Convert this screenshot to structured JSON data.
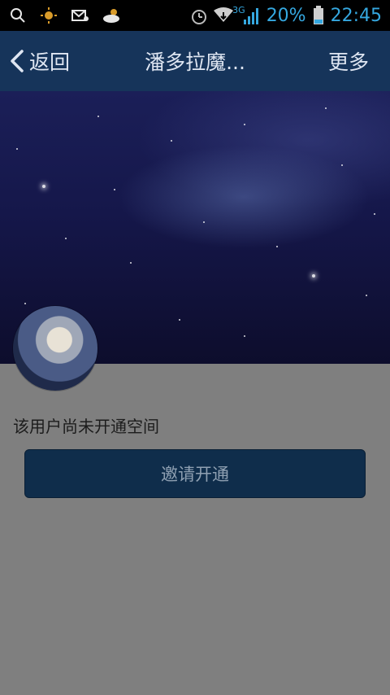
{
  "status_bar": {
    "battery": "20%",
    "time": "22:45",
    "network": "3G",
    "icons": [
      "search-icon",
      "sun-icon",
      "heart-message-icon",
      "weather-icon",
      "alarm-icon",
      "wifi-icon",
      "signal-icon",
      "battery-icon"
    ]
  },
  "nav": {
    "back_label": "返回",
    "title": "潘多拉魔...",
    "more_label": "更多"
  },
  "profile": {
    "notice": "该用户尚未开通空间",
    "invite_label": "邀请开通"
  }
}
